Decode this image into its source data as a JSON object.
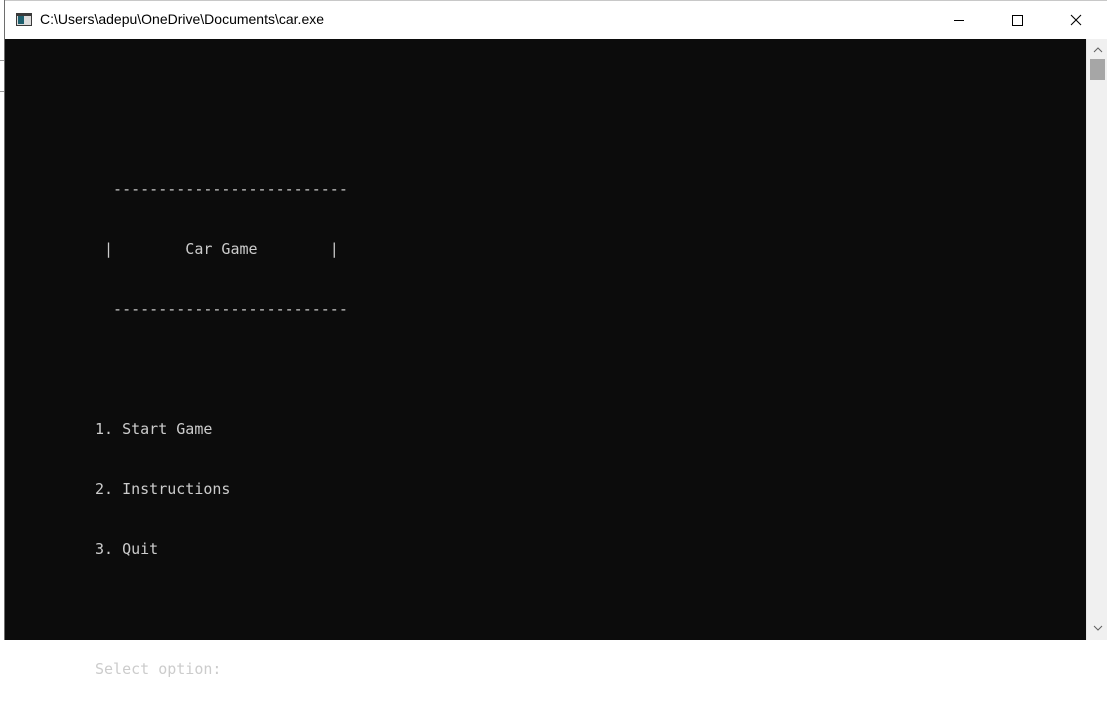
{
  "window": {
    "title": "C:\\Users\\adepu\\OneDrive\\Documents\\car.exe",
    "icon": "console-app-icon",
    "controls": {
      "minimize": "minimize-icon",
      "maximize": "maximize-icon",
      "close": "close-icon"
    }
  },
  "console": {
    "lines": [
      "  --------------------------",
      " |        Car Game        |",
      "  --------------------------",
      "",
      "1. Start Game",
      "2. Instructions",
      "3. Quit",
      "",
      "Select option: "
    ]
  },
  "colors": {
    "console_bg": "#0c0c0c",
    "console_text": "#cccccc",
    "titlebar_bg": "#ffffff"
  }
}
